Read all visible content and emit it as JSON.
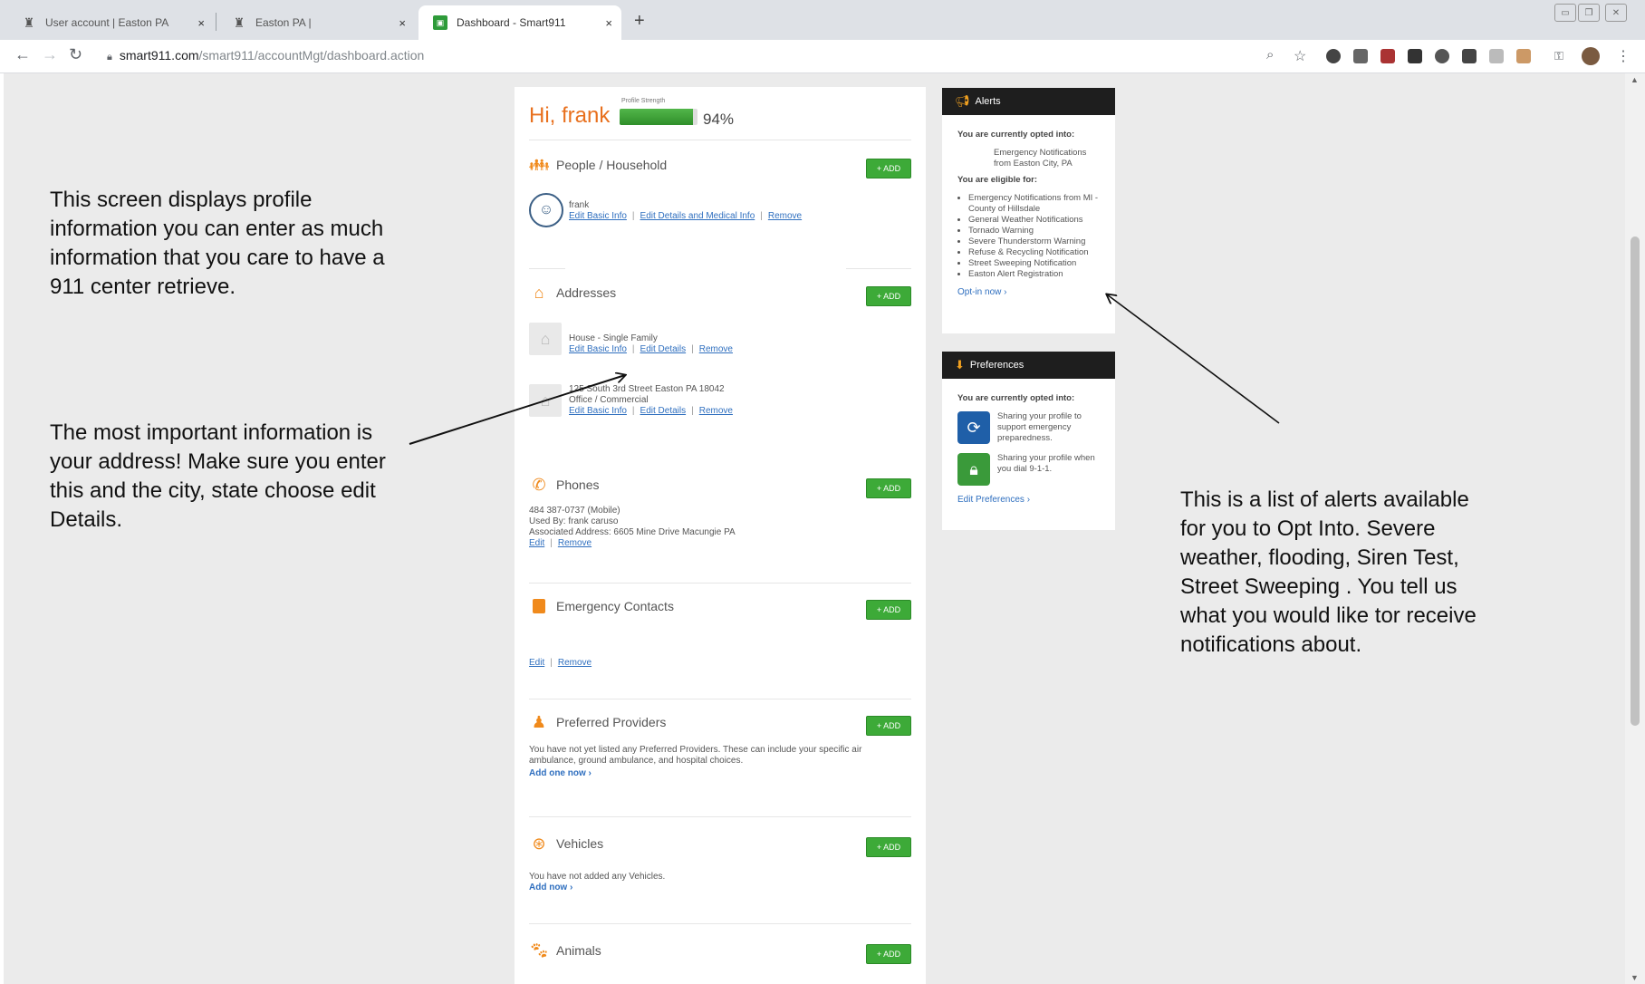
{
  "browser": {
    "tabs": [
      {
        "label": "User account | Easton PA",
        "active": false
      },
      {
        "label": "Easton PA |",
        "active": false
      },
      {
        "label": "Dashboard - Smart911",
        "active": true
      }
    ],
    "new_tab": "+",
    "close_glyph": "×",
    "url_host": "smart911.com",
    "url_path": "/smart911/accountMgt/dashboard.action"
  },
  "annotations": {
    "left_top": "This screen displays profile information you can enter as much information that you care to have a 911 center retrieve.",
    "left_middle": "The most important information is your address! Make sure you enter this and the city, state choose edit Details.",
    "right": "This is a list of alerts available for you to Opt Into.   Severe weather, flooding, Siren Test, Street Sweeping . You tell us what you would like tor receive notifications about."
  },
  "profile": {
    "greeting": "Hi, frank",
    "strength_label": "Profile Strength",
    "strength_value": "94%",
    "strength_fraction": 0.94
  },
  "add_label": "+ ADD",
  "link_sep": "|",
  "sections": {
    "people": {
      "title": "People / Household",
      "person_name": "frank",
      "links": [
        "Edit Basic Info",
        "Edit Details and Medical Info",
        "Remove"
      ]
    },
    "addresses": {
      "title": "Addresses",
      "items": [
        {
          "line1": "House - Single Family",
          "line2": "",
          "links": [
            "Edit Basic Info",
            "Edit Details",
            "Remove"
          ]
        },
        {
          "line1": "125 South 3rd Street Easton PA 18042",
          "line2": "Office / Commercial",
          "links": [
            "Edit Basic Info",
            "Edit Details",
            "Remove"
          ]
        }
      ]
    },
    "phones": {
      "title": "Phones",
      "number": "484 387-0737 (Mobile)",
      "used_by": "Used By: frank caruso",
      "address": "Associated Address: 6605 Mine Drive Macungie PA",
      "links": [
        "Edit",
        "Remove"
      ]
    },
    "contacts": {
      "title": "Emergency Contacts",
      "links": [
        "Edit",
        "Remove"
      ]
    },
    "providers": {
      "title": "Preferred Providers",
      "text": "You have not yet listed any Preferred Providers. These can include your specific air ambulance, ground ambulance, and hospital choices.",
      "cta": "Add one now ›"
    },
    "vehicles": {
      "title": "Vehicles",
      "text": "You have not added any Vehicles.",
      "cta": "Add now ›"
    },
    "animals": {
      "title": "Animals"
    }
  },
  "alerts": {
    "title": "Alerts",
    "opted_heading": "You are currently opted into:",
    "opted_item": "Emergency Notifications from Easton City, PA",
    "eligible_heading": "You are eligible for:",
    "eligible": [
      "Emergency Notifications from MI - County of Hillsdale",
      "General Weather Notifications",
      "Tornado Warning",
      "Severe Thunderstorm Warning",
      "Refuse & Recycling Notification",
      "Street Sweeping Notification",
      "Easton Alert Registration"
    ],
    "cta": "Opt-in now ›"
  },
  "preferences": {
    "title": "Preferences",
    "heading": "You are currently opted into:",
    "items": [
      {
        "text": "Sharing your profile to support emergency preparedness.",
        "color": "#1f5fa8"
      },
      {
        "text": "Sharing your profile when you dial 9-1-1.",
        "color": "#3a9a3a"
      }
    ],
    "cta": "Edit Preferences ›"
  },
  "colors": {
    "accent_orange": "#e8701e",
    "add_green": "#3daa38",
    "link_blue": "#2f6fbf"
  }
}
